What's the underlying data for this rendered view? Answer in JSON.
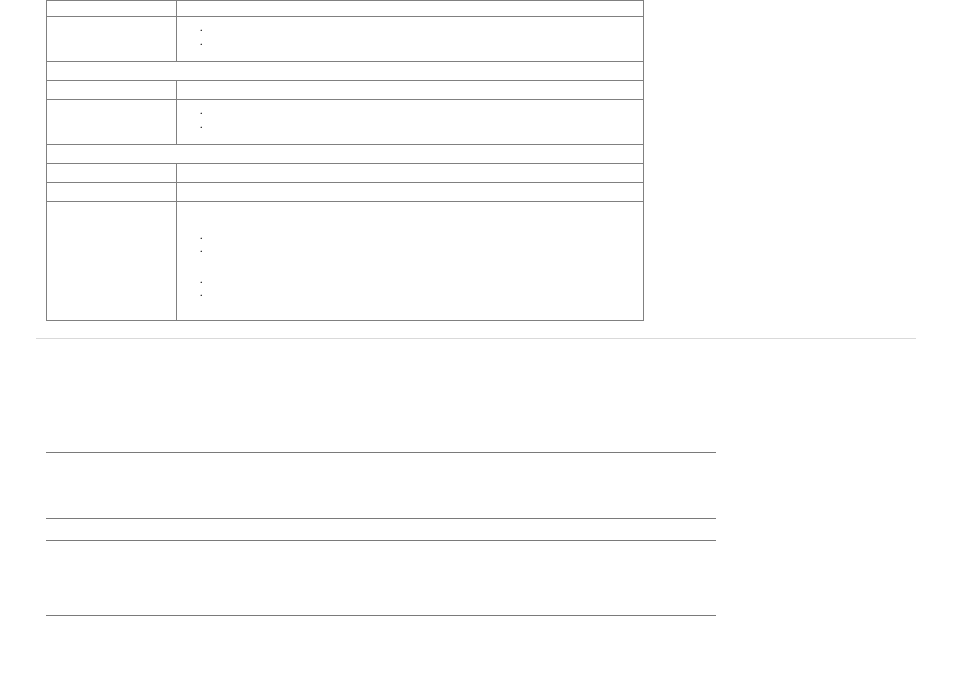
{
  "table": {
    "row1_marks": [
      "·",
      "·"
    ],
    "row2_marks": [
      "·",
      "·"
    ],
    "row3_marks": [
      "·",
      "·",
      " ",
      "·",
      "·"
    ]
  }
}
